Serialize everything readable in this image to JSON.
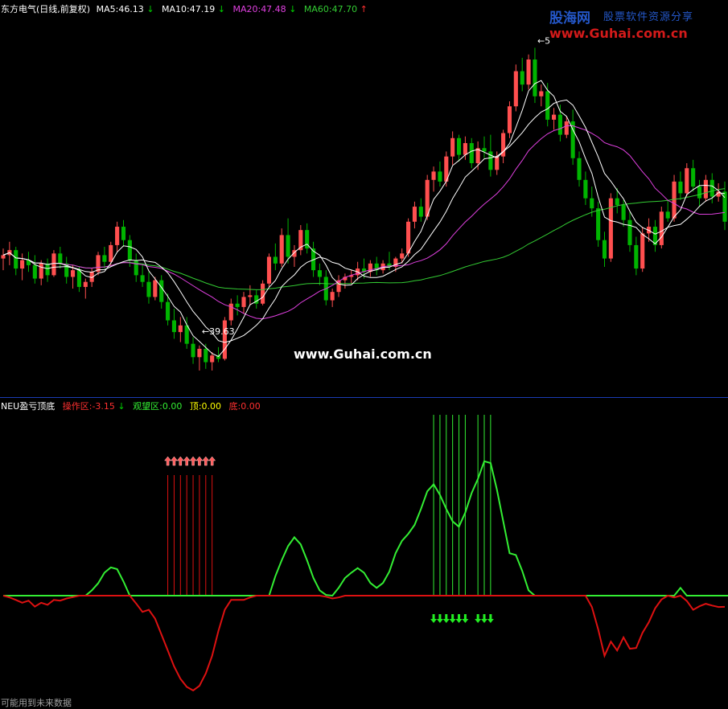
{
  "header_main": {
    "stock": "东方电气(日线,前复权)",
    "ma5": "MA5:46.13",
    "ma5_arrow": "↓",
    "ma10": "MA10:47.19",
    "ma10_arrow": "↓",
    "ma20": "MA20:47.48",
    "ma20_arrow": "↓",
    "ma60": "MA60:47.70",
    "ma60_arrow": "↑"
  },
  "header_indicator": {
    "name": "NEU盈亏顶底",
    "op": "操作区:-3.15",
    "op_arrow": "↓",
    "watch": "观望区:0.00",
    "top": "顶:0.00",
    "bottom": "底:0.00"
  },
  "footer_note": "可能用到未来数据",
  "watermark": "www.Guhai.com.cn",
  "logo": {
    "name": "股海网",
    "slogan": "股票软件资源分享",
    "url": "www.Guhai.com.cn"
  },
  "colors": {
    "up": "#ff4f4f",
    "down": "#00b400",
    "ma5": "#ffffff",
    "ma10": "#ffffff",
    "ma20": "#e040e0",
    "ma60": "#33cc33",
    "op": "#dd1111",
    "watch": "#33ee33",
    "divider": "#1a3cb4"
  },
  "chart_data": [
    {
      "type": "candlestick",
      "panel": "price",
      "annotations": [
        {
          "label": "39.63",
          "value": 39.63
        },
        {
          "label": "5",
          "value": 56.2
        }
      ],
      "candles": [
        [
          43.6,
          44.2,
          42.9,
          43.8
        ],
        [
          43.8,
          44.6,
          43.2,
          44.1
        ],
        [
          44.1,
          44.3,
          42.6,
          43.0
        ],
        [
          43.0,
          43.9,
          42.3,
          43.5
        ],
        [
          43.5,
          44.0,
          42.8,
          43.2
        ],
        [
          43.2,
          43.8,
          42.1,
          42.4
        ],
        [
          42.4,
          43.5,
          42.0,
          43.3
        ],
        [
          43.3,
          43.6,
          42.2,
          42.6
        ],
        [
          42.6,
          44.1,
          42.5,
          43.9
        ],
        [
          43.9,
          44.3,
          43.0,
          43.3
        ],
        [
          43.3,
          43.7,
          42.1,
          42.5
        ],
        [
          42.5,
          43.2,
          41.8,
          42.9
        ],
        [
          42.9,
          43.1,
          41.6,
          41.9
        ],
        [
          41.9,
          42.4,
          41.2,
          42.2
        ],
        [
          42.2,
          43.0,
          41.9,
          42.8
        ],
        [
          42.8,
          44.0,
          42.6,
          43.8
        ],
        [
          43.8,
          44.3,
          43.0,
          43.4
        ],
        [
          43.4,
          44.6,
          43.2,
          44.4
        ],
        [
          44.4,
          45.8,
          44.0,
          45.5
        ],
        [
          45.5,
          45.9,
          44.3,
          44.7
        ],
        [
          44.7,
          45.0,
          43.1,
          43.5
        ],
        [
          43.5,
          43.9,
          42.2,
          42.6
        ],
        [
          42.6,
          43.3,
          41.9,
          42.2
        ],
        [
          42.2,
          42.8,
          40.9,
          41.3
        ],
        [
          41.3,
          42.5,
          41.1,
          42.3
        ],
        [
          42.3,
          42.6,
          40.6,
          41.0
        ],
        [
          41.0,
          41.5,
          39.6,
          39.9
        ],
        [
          39.9,
          40.6,
          38.8,
          39.2
        ],
        [
          39.2,
          40.1,
          38.6,
          39.6
        ],
        [
          39.6,
          40.1,
          38.2,
          38.5
        ],
        [
          38.5,
          38.9,
          37.3,
          37.7
        ],
        [
          37.7,
          38.4,
          36.9,
          38.2
        ],
        [
          38.2,
          38.5,
          37.0,
          37.4
        ],
        [
          37.4,
          38.0,
          36.9,
          37.8
        ],
        [
          37.8,
          38.3,
          37.4,
          37.6
        ],
        [
          37.6,
          40.1,
          37.5,
          39.9
        ],
        [
          39.9,
          41.2,
          39.6,
          40.9
        ],
        [
          40.9,
          41.4,
          40.2,
          40.7
        ],
        [
          40.7,
          41.6,
          40.3,
          41.3
        ],
        [
          41.3,
          42.0,
          40.8,
          41.4
        ],
        [
          41.4,
          41.7,
          40.6,
          40.9
        ],
        [
          40.9,
          42.3,
          40.8,
          42.1
        ],
        [
          42.1,
          43.9,
          41.9,
          43.7
        ],
        [
          43.7,
          44.5,
          42.9,
          43.3
        ],
        [
          43.3,
          45.4,
          43.1,
          45.0
        ],
        [
          45.0,
          46.0,
          43.3,
          43.7
        ],
        [
          43.7,
          44.4,
          43.1,
          44.1
        ],
        [
          44.1,
          45.6,
          43.8,
          45.3
        ],
        [
          45.3,
          45.7,
          43.9,
          44.2
        ],
        [
          44.2,
          44.6,
          42.5,
          42.9
        ],
        [
          42.9,
          43.3,
          42.0,
          42.5
        ],
        [
          42.5,
          42.9,
          40.8,
          41.1
        ],
        [
          41.1,
          41.8,
          40.7,
          41.6
        ],
        [
          41.6,
          42.6,
          41.3,
          42.3
        ],
        [
          42.3,
          42.7,
          41.8,
          42.5
        ],
        [
          42.5,
          42.9,
          42.1,
          42.6
        ],
        [
          42.6,
          43.4,
          42.3,
          43.0
        ],
        [
          43.0,
          43.6,
          42.4,
          42.8
        ],
        [
          42.8,
          43.5,
          42.5,
          43.3
        ],
        [
          43.3,
          43.7,
          42.6,
          42.9
        ],
        [
          42.9,
          43.5,
          42.7,
          43.3
        ],
        [
          43.3,
          44.0,
          42.9,
          43.1
        ],
        [
          43.1,
          43.7,
          42.8,
          43.6
        ],
        [
          43.6,
          44.2,
          43.3,
          43.9
        ],
        [
          43.9,
          46.0,
          43.7,
          45.8
        ],
        [
          45.8,
          47.0,
          45.4,
          46.7
        ],
        [
          46.7,
          47.2,
          45.8,
          46.1
        ],
        [
          46.1,
          48.6,
          45.9,
          48.3
        ],
        [
          48.3,
          49.1,
          47.6,
          48.8
        ],
        [
          48.8,
          49.4,
          47.9,
          48.2
        ],
        [
          48.2,
          50.0,
          47.9,
          49.7
        ],
        [
          49.7,
          51.2,
          49.2,
          50.8
        ],
        [
          50.8,
          51.0,
          49.4,
          49.8
        ],
        [
          49.8,
          50.9,
          49.5,
          50.5
        ],
        [
          50.5,
          50.8,
          49.0,
          49.3
        ],
        [
          49.3,
          50.6,
          48.9,
          50.2
        ],
        [
          50.2,
          50.9,
          49.6,
          50.0
        ],
        [
          50.0,
          51.0,
          48.5,
          48.9
        ],
        [
          48.9,
          50.0,
          48.6,
          49.7
        ],
        [
          49.7,
          51.3,
          49.3,
          51.1
        ],
        [
          51.1,
          53.0,
          50.8,
          52.7
        ],
        [
          52.7,
          55.2,
          52.4,
          54.8
        ],
        [
          54.8,
          55.6,
          53.6,
          54.0
        ],
        [
          54.0,
          55.8,
          53.7,
          55.5
        ],
        [
          55.5,
          56.2,
          52.9,
          53.3
        ],
        [
          53.3,
          54.0,
          52.7,
          53.6
        ],
        [
          53.6,
          54.1,
          51.5,
          51.9
        ],
        [
          51.9,
          52.6,
          51.3,
          52.2
        ],
        [
          52.2,
          52.8,
          50.6,
          51.0
        ],
        [
          51.0,
          52.1,
          50.8,
          51.8
        ],
        [
          51.8,
          52.5,
          49.2,
          49.6
        ],
        [
          49.6,
          50.0,
          47.9,
          48.3
        ],
        [
          48.3,
          48.8,
          46.8,
          47.2
        ],
        [
          47.2,
          47.9,
          46.1,
          46.6
        ],
        [
          46.6,
          47.0,
          44.3,
          44.7
        ],
        [
          44.7,
          45.2,
          43.1,
          43.6
        ],
        [
          43.6,
          47.5,
          43.4,
          47.2
        ],
        [
          47.2,
          47.8,
          46.3,
          46.8
        ],
        [
          46.8,
          47.1,
          45.5,
          45.9
        ],
        [
          45.9,
          46.4,
          44.0,
          44.4
        ],
        [
          44.4,
          44.9,
          42.6,
          43.0
        ],
        [
          43.0,
          45.5,
          42.8,
          45.1
        ],
        [
          45.1,
          46.0,
          44.6,
          45.5
        ],
        [
          45.5,
          45.9,
          44.0,
          44.4
        ],
        [
          44.4,
          46.7,
          44.2,
          46.4
        ],
        [
          46.4,
          47.1,
          45.8,
          46.0
        ],
        [
          46.0,
          48.6,
          45.8,
          48.2
        ],
        [
          48.2,
          48.8,
          47.1,
          47.5
        ],
        [
          47.5,
          49.3,
          47.3,
          49.0
        ],
        [
          49.0,
          49.5,
          47.6,
          47.9
        ],
        [
          47.9,
          48.3,
          46.7,
          47.2
        ],
        [
          47.2,
          48.6,
          47.0,
          48.3
        ],
        [
          48.3,
          48.7,
          46.9,
          47.3
        ],
        [
          47.3,
          48.1,
          47.0,
          47.6
        ],
        [
          47.6,
          48.2,
          45.3,
          45.8
        ]
      ]
    },
    {
      "type": "line",
      "panel": "indicator",
      "series": [
        {
          "name": "操作区",
          "values": [
            0.0,
            -0.5,
            -1.2,
            -2.0,
            -1.4,
            -3.1,
            -2.0,
            -2.6,
            -1.2,
            -1.4,
            -0.8,
            -0.4,
            0.0,
            0.0,
            0.0,
            0.0,
            0.0,
            0.0,
            0.0,
            0.0,
            0.0,
            -2.2,
            -4.6,
            -4.0,
            -6.5,
            -11.0,
            -15.5,
            -20.0,
            -23.5,
            -25.8,
            -26.8,
            -25.5,
            -22.0,
            -17.0,
            -10.0,
            -4.0,
            -1.2,
            -1.2,
            -1.2,
            -0.5,
            0.0,
            0.0,
            0.0,
            0.0,
            0.0,
            0.0,
            0.0,
            0.0,
            0.0,
            0.0,
            0.0,
            -0.3,
            -0.8,
            -0.5,
            0.0,
            0.0,
            0.0,
            0.0,
            0.0,
            0.0,
            0.0,
            0.0,
            0.0,
            0.0,
            0.0,
            0.0,
            0.0,
            0.0,
            0.0,
            0.0,
            0.0,
            0.0,
            0.0,
            0.0,
            0.0,
            0.0,
            0.0,
            0.0,
            0.0,
            0.0,
            0.0,
            0.0,
            0.0,
            0.0,
            0.0,
            0.0,
            0.0,
            0.0,
            0.0,
            0.0,
            0.0,
            0.0,
            0.0,
            -3.2,
            -9.5,
            -17.0,
            -13.0,
            -15.5,
            -11.8,
            -15.0,
            -14.8,
            -10.5,
            -7.5,
            -3.6,
            -1.1,
            0.0,
            -0.5,
            0.0,
            -1.5,
            -4.0,
            -3.0,
            -2.3,
            -2.8,
            -3.2,
            -3.15
          ]
        },
        {
          "name": "观望区",
          "values": [
            0.0,
            0.0,
            0.0,
            0.0,
            0.0,
            0.0,
            0.0,
            0.0,
            0.0,
            0.0,
            0.0,
            0.0,
            0.0,
            0.0,
            0.0,
            0.0,
            0.0,
            0.0,
            0.0,
            0.0,
            0.0,
            0.0,
            0.0,
            0.0,
            0.0,
            0.0,
            0.0,
            0.0,
            0.0,
            0.0,
            0.0,
            0.0,
            0.0,
            0.0,
            0.0,
            0.0,
            0.0,
            0.0,
            0.0,
            0.0,
            0.0,
            0.0,
            0.0,
            0.0,
            0.0,
            0.0,
            0.0,
            0.0,
            0.0,
            0.0,
            0.0,
            0.0,
            0.0,
            0.0,
            0.0,
            0.0,
            0.0,
            0.0,
            0.0,
            0.0,
            0.0,
            0.0,
            0.0,
            0.0,
            0.0,
            0.0,
            0.0,
            0.0,
            0.0,
            0.0,
            0.0,
            0.0,
            0.0,
            0.0,
            0.0,
            0.0,
            0.0,
            0.0,
            0.0,
            0.0,
            0.0,
            0.0,
            0.0,
            0.0,
            0.0,
            0.0,
            0.0,
            0.0,
            0.0,
            0.0,
            0.0,
            0.0,
            0.0,
            0.0,
            0.0,
            0.0,
            0.0,
            0.0,
            0.0,
            0.0,
            0.0,
            0.0,
            0.0,
            0.0,
            0.0,
            0.0,
            0.0,
            0.0,
            0.0,
            0.0,
            0.0,
            0.0,
            0.0,
            0.0,
            0.0,
            0.0
          ]
        }
      ],
      "watch_curve": [
        0,
        0,
        0,
        0,
        0,
        0,
        0,
        0,
        0,
        0,
        0,
        0,
        0,
        0,
        1.5,
        3.5,
        6.5,
        8.0,
        7.5,
        4.0,
        0,
        0,
        0,
        0,
        0,
        0,
        0,
        0,
        0,
        0,
        0,
        0,
        0,
        0,
        0,
        0,
        0,
        0,
        0,
        0,
        0,
        0,
        0,
        5.5,
        10.0,
        14.0,
        16.5,
        14.5,
        10.0,
        5.0,
        1.5,
        0.2,
        0,
        2.2,
        5.0,
        6.5,
        7.8,
        6.5,
        3.6,
        2.2,
        3.6,
        6.8,
        12.0,
        15.5,
        17.5,
        20.0,
        24.5,
        29.5,
        31.5,
        28.5,
        24.5,
        21.0,
        19.5,
        23.5,
        29.0,
        33.0,
        38.0,
        37.5,
        30.0,
        21.0,
        12.0,
        11.5,
        7.0,
        1.5,
        0,
        0,
        0,
        0,
        0,
        0,
        0,
        0,
        0,
        0,
        0,
        0,
        0,
        0,
        0,
        0,
        0,
        0,
        0,
        0,
        0,
        0,
        0,
        2.2,
        0,
        0,
        0,
        0,
        0,
        0,
        0,
        0,
        0,
        0
      ],
      "buy_signal_bars": [
        26,
        27,
        28,
        29,
        30,
        31,
        32,
        33
      ],
      "sell_signal_bars": [
        68,
        69,
        70,
        71,
        72,
        73,
        75,
        76,
        77
      ]
    }
  ]
}
